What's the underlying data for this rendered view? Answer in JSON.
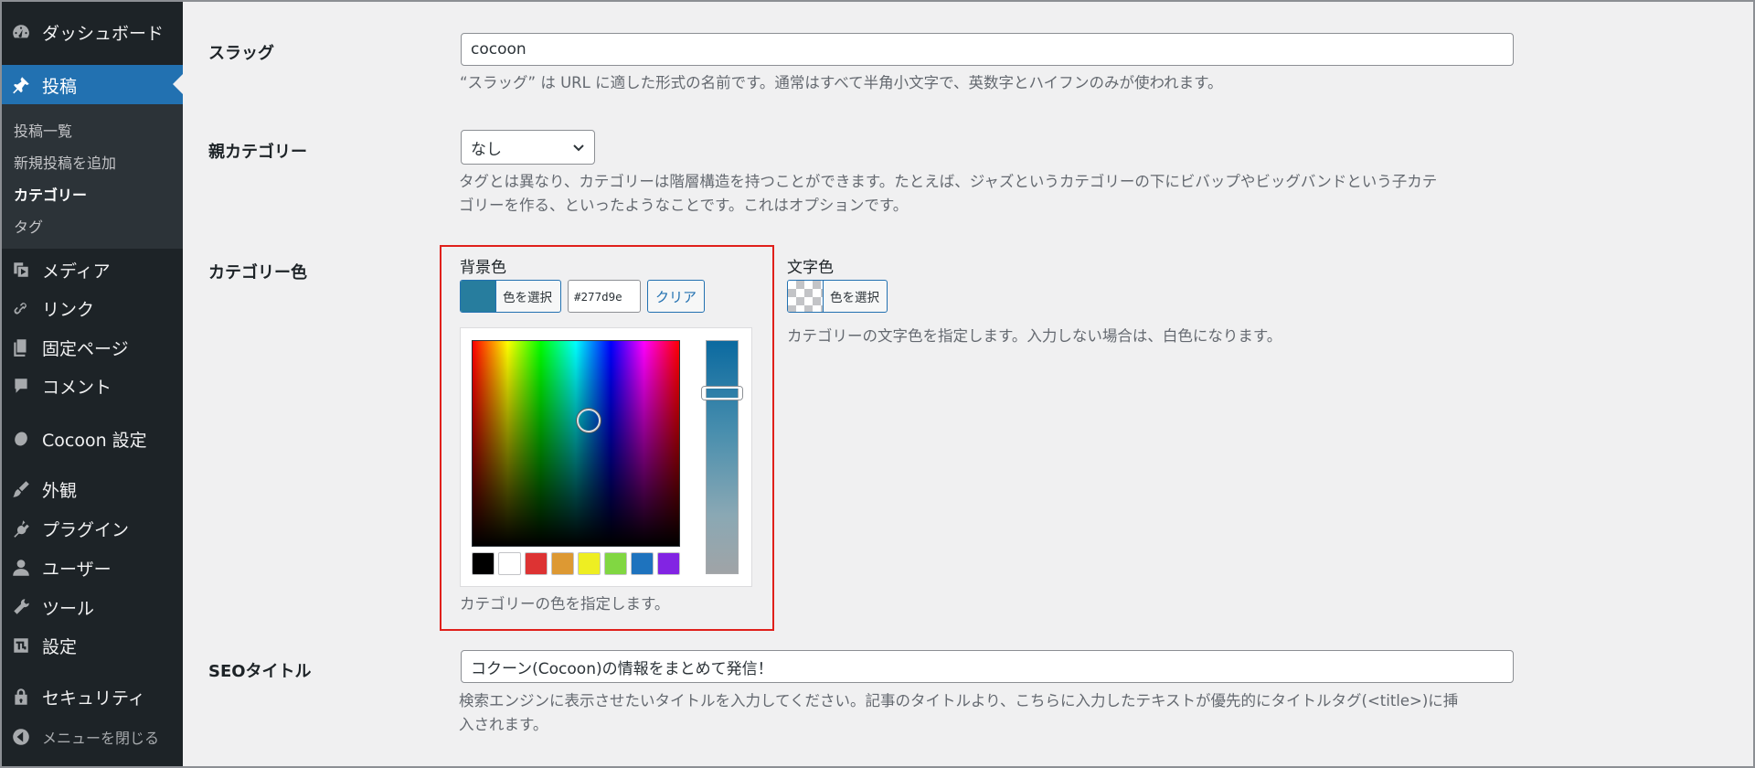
{
  "sidebar": {
    "items": [
      {
        "label": "ダッシュボード",
        "icon": "dashboard-icon"
      },
      {
        "label": "投稿",
        "icon": "pin-icon",
        "current": true
      },
      {
        "label": "メディア",
        "icon": "media-icon"
      },
      {
        "label": "リンク",
        "icon": "link-icon"
      },
      {
        "label": "固定ページ",
        "icon": "pages-icon"
      },
      {
        "label": "コメント",
        "icon": "comment-icon"
      },
      {
        "label": "Cocoon 設定",
        "icon": "cocoon-icon"
      },
      {
        "label": "外観",
        "icon": "brush-icon"
      },
      {
        "label": "プラグイン",
        "icon": "plugin-icon"
      },
      {
        "label": "ユーザー",
        "icon": "user-icon"
      },
      {
        "label": "ツール",
        "icon": "wrench-icon"
      },
      {
        "label": "設定",
        "icon": "settings-icon"
      },
      {
        "label": "セキュリティ",
        "icon": "lock-icon"
      }
    ],
    "submenu": [
      "投稿一覧",
      "新規投稿を追加",
      "カテゴリー",
      "タグ"
    ],
    "collapse_label": "メニューを閉じる"
  },
  "form": {
    "slug": {
      "label": "スラッグ",
      "value": "cocoon",
      "description": "“スラッグ” は URL に適した形式の名前です。通常はすべて半角小文字で、英数字とハイフンのみが使われます。"
    },
    "parent": {
      "label": "親カテゴリー",
      "selected": "なし",
      "description_line1": "タグとは異なり、カテゴリーは階層構造を持つことができます。たとえば、ジャズというカテゴリーの下にビバップやビッグバンドという子カテ",
      "description_line2": "ゴリーを作る、といったようなことです。これはオプションです。"
    },
    "category_color": {
      "label": "カテゴリー色",
      "bg": {
        "label": "背景色",
        "select_button": "色を選択",
        "hex_value": "#277d9e",
        "clear_button": "クリア",
        "description": "カテゴリーの色を指定します。",
        "swatch_color": "#277d9e",
        "palette": [
          "#000000",
          "#ffffff",
          "#dd3333",
          "#dd9933",
          "#eeee22",
          "#81d742",
          "#1e73be",
          "#8224e3"
        ]
      },
      "text": {
        "label": "文字色",
        "select_button": "色を選択",
        "description": "カテゴリーの文字色を指定します。入力しない場合は、白色になります。"
      }
    },
    "seo_title": {
      "label": "SEOタイトル",
      "value": "コクーン(Cocoon)の情報をまとめて発信！",
      "description_line1": "検索エンジンに表示させたいタイトルを入力してください。記事のタイトルより、こちらに入力したテキストが優先的にタイトルタグ(<title>)に挿",
      "description_line2": "入されます。"
    }
  }
}
